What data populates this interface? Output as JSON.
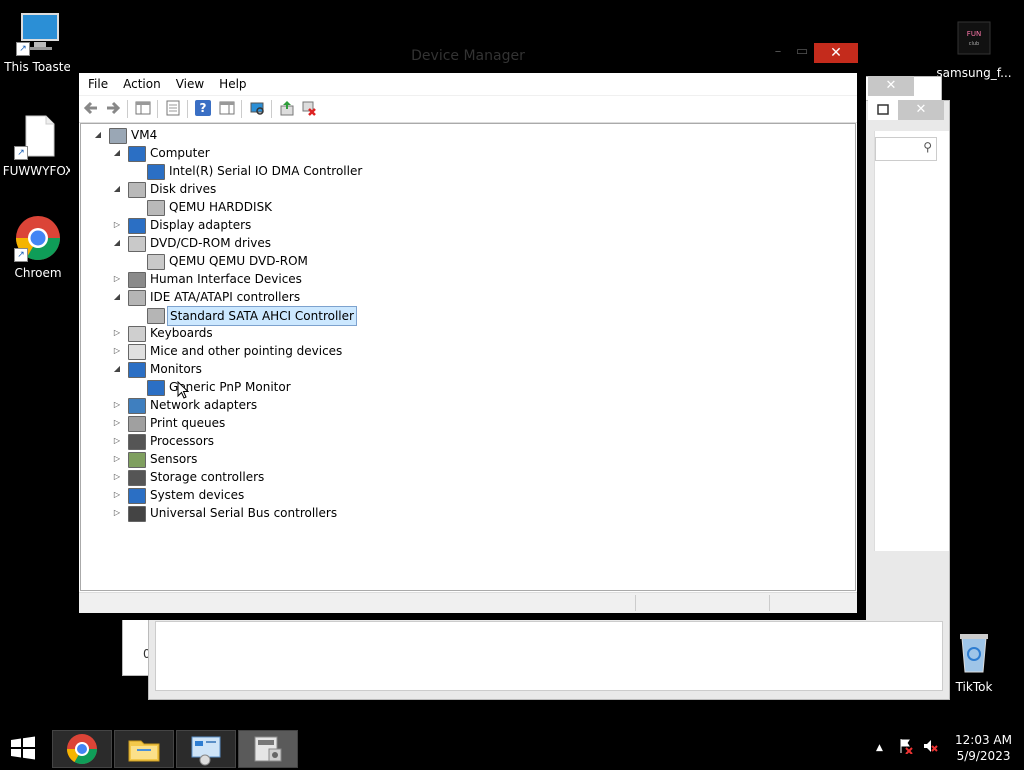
{
  "desktop": {
    "icons_left": [
      {
        "label": "This Toaster",
        "icon": "computer-icon"
      },
      {
        "label": "FUWWYFOX",
        "icon": "file-icon"
      },
      {
        "label": "Chroem",
        "icon": "chrome-icon"
      }
    ],
    "icons_right": [
      {
        "label": "samsung_f...",
        "icon": "image-file-icon"
      },
      {
        "label": "TikTok",
        "icon": "recycle-bin-icon"
      }
    ],
    "background_window_fragment": "0"
  },
  "device_manager": {
    "title": "Device Manager",
    "menu": [
      "File",
      "Action",
      "View",
      "Help"
    ],
    "toolbar_icons": [
      "back-icon",
      "forward-icon",
      "show-hide-tree-icon",
      "properties-icon",
      "help-icon",
      "action-pane-icon",
      "scan-hardware-icon",
      "update-driver-icon",
      "uninstall-device-icon"
    ],
    "tree": [
      {
        "label": "VM4",
        "level": 0,
        "expander": "collapse",
        "icon": "computer-icon"
      },
      {
        "label": "Computer",
        "level": 1,
        "expander": "collapse",
        "icon": "monitor-icon"
      },
      {
        "label": "Intel(R) Serial IO DMA Controller",
        "level": 2,
        "expander": "",
        "icon": "monitor-icon"
      },
      {
        "label": "Disk drives",
        "level": 1,
        "expander": "collapse",
        "icon": "disk-drive-icon"
      },
      {
        "label": "QEMU HARDDISK",
        "level": 2,
        "expander": "",
        "icon": "disk-drive-icon"
      },
      {
        "label": "Display adapters",
        "level": 1,
        "expander": "expand",
        "icon": "display-adapter-icon"
      },
      {
        "label": "DVD/CD-ROM drives",
        "level": 1,
        "expander": "collapse",
        "icon": "dvd-drive-icon"
      },
      {
        "label": "QEMU QEMU DVD-ROM",
        "level": 2,
        "expander": "",
        "icon": "dvd-drive-icon"
      },
      {
        "label": "Human Interface Devices",
        "level": 1,
        "expander": "expand",
        "icon": "hid-icon"
      },
      {
        "label": "IDE ATA/ATAPI controllers",
        "level": 1,
        "expander": "collapse",
        "icon": "ide-controller-icon"
      },
      {
        "label": "Standard SATA AHCI Controller",
        "level": 2,
        "expander": "",
        "icon": "ide-controller-icon",
        "selected": true
      },
      {
        "label": "Keyboards",
        "level": 1,
        "expander": "expand",
        "icon": "keyboard-icon"
      },
      {
        "label": "Mice and other pointing devices",
        "level": 1,
        "expander": "expand",
        "icon": "mouse-icon"
      },
      {
        "label": "Monitors",
        "level": 1,
        "expander": "collapse",
        "icon": "monitor-icon"
      },
      {
        "label": "Generic PnP Monitor",
        "level": 2,
        "expander": "",
        "icon": "monitor-icon"
      },
      {
        "label": "Network adapters",
        "level": 1,
        "expander": "expand",
        "icon": "network-adapter-icon"
      },
      {
        "label": "Print queues",
        "level": 1,
        "expander": "expand",
        "icon": "printer-icon"
      },
      {
        "label": "Processors",
        "level": 1,
        "expander": "expand",
        "icon": "processor-icon"
      },
      {
        "label": "Sensors",
        "level": 1,
        "expander": "expand",
        "icon": "sensor-icon"
      },
      {
        "label": "Storage controllers",
        "level": 1,
        "expander": "expand",
        "icon": "storage-controller-icon"
      },
      {
        "label": "System devices",
        "level": 1,
        "expander": "expand",
        "icon": "system-devices-icon"
      },
      {
        "label": "Universal Serial Bus controllers",
        "level": 1,
        "expander": "expand",
        "icon": "usb-icon"
      }
    ]
  },
  "taskbar": {
    "buttons": [
      {
        "name": "start-button",
        "icon": "windows-logo-icon"
      },
      {
        "name": "chrome-taskbar-button",
        "icon": "chrome-icon"
      },
      {
        "name": "file-explorer-taskbar-button",
        "icon": "file-explorer-icon"
      },
      {
        "name": "control-panel-taskbar-button",
        "icon": "control-panel-icon"
      },
      {
        "name": "device-manager-taskbar-button",
        "icon": "device-manager-icon",
        "active": true
      }
    ],
    "time": "12:03 AM",
    "date": "5/9/2023"
  },
  "colors": {
    "close_button": "#c42b1c",
    "selection_bg": "#cce8ff",
    "selection_border": "#7da2ce"
  }
}
